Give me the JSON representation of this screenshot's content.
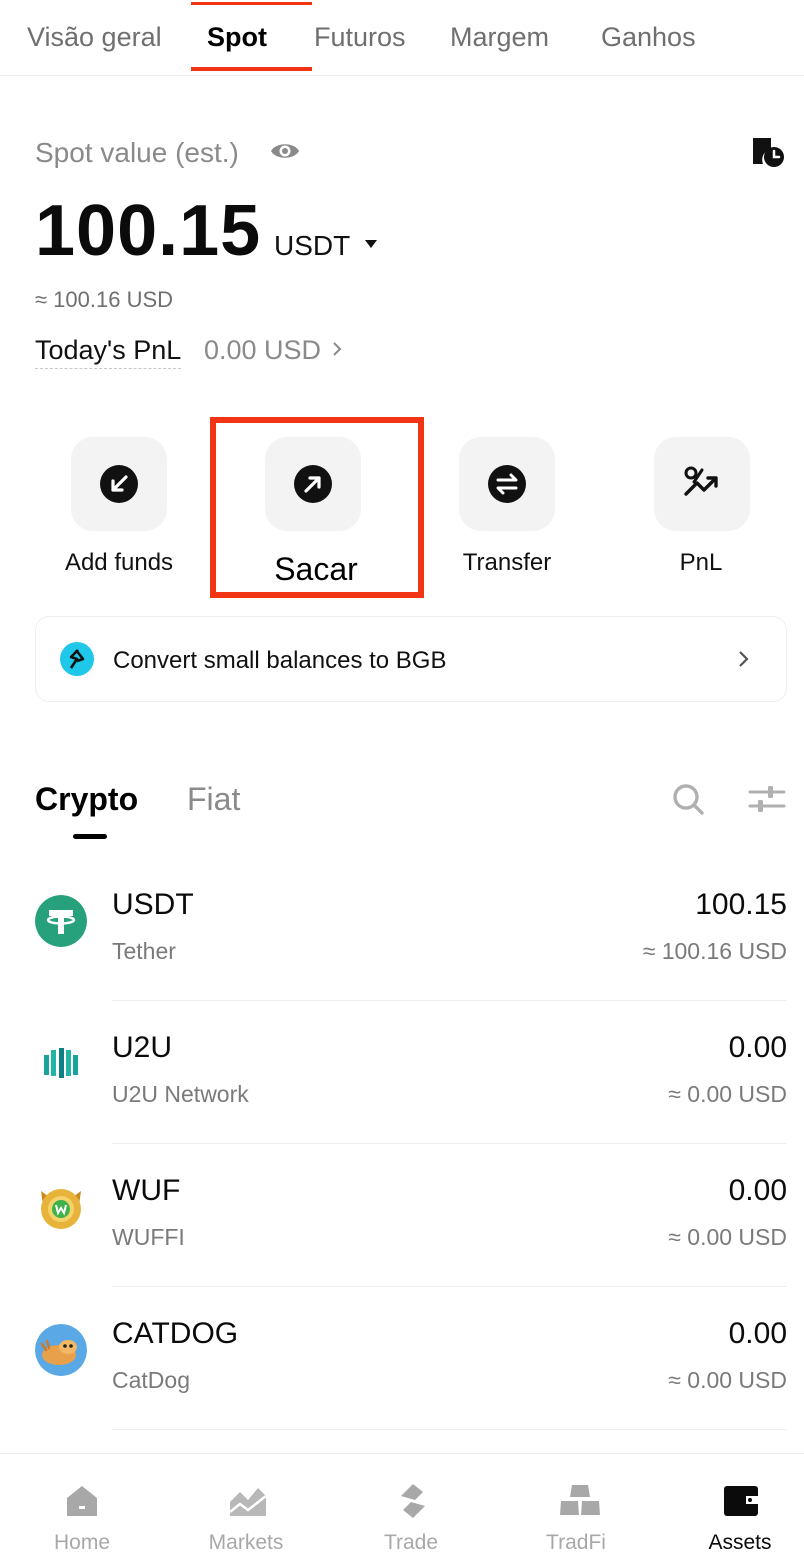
{
  "top_tabs": [
    {
      "label": "Visão geral",
      "active": false
    },
    {
      "label": "Spot",
      "active": true
    },
    {
      "label": "Futuros",
      "active": false
    },
    {
      "label": "Margem",
      "active": false
    },
    {
      "label": "Ganhos",
      "active": false
    }
  ],
  "spot": {
    "label": "Spot value (est.)",
    "value": "100.15",
    "unit": "USDT",
    "approx": "≈ 100.16 USD",
    "pnl_label": "Today's PnL",
    "pnl_value": "0.00 USD"
  },
  "actions": [
    {
      "label": "Add funds",
      "icon": "arrow-down-left-icon"
    },
    {
      "label": "Sacar",
      "icon": "arrow-up-right-icon",
      "highlighted": true
    },
    {
      "label": "Transfer",
      "icon": "transfer-icon"
    },
    {
      "label": "PnL",
      "icon": "pnl-chart-icon"
    }
  ],
  "convert_banner": {
    "text": "Convert small balances to BGB"
  },
  "asset_tabs": [
    {
      "label": "Crypto",
      "active": true
    },
    {
      "label": "Fiat",
      "active": false
    }
  ],
  "coins": [
    {
      "symbol": "USDT",
      "name": "Tether",
      "amount": "100.15",
      "usd": "≈ 100.16 USD",
      "color": "#26a17b"
    },
    {
      "symbol": "U2U",
      "name": "U2U Network",
      "amount": "0.00",
      "usd": "≈ 0.00 USD",
      "color": "#1aa39a"
    },
    {
      "symbol": "WUF",
      "name": "WUFFI",
      "amount": "0.00",
      "usd": "≈ 0.00 USD",
      "color": "#e8b33a"
    },
    {
      "symbol": "CATDOG",
      "name": "CatDog",
      "amount": "0.00",
      "usd": "≈ 0.00 USD",
      "color": "#5aa8e6"
    }
  ],
  "bottom_nav": [
    {
      "label": "Home",
      "active": false
    },
    {
      "label": "Markets",
      "active": false
    },
    {
      "label": "Trade",
      "active": false
    },
    {
      "label": "TradFi",
      "active": false
    },
    {
      "label": "Assets",
      "active": true
    }
  ],
  "colors": {
    "accent": "#f03414",
    "text": "#0b0b0b",
    "muted": "#8a8a8a"
  }
}
